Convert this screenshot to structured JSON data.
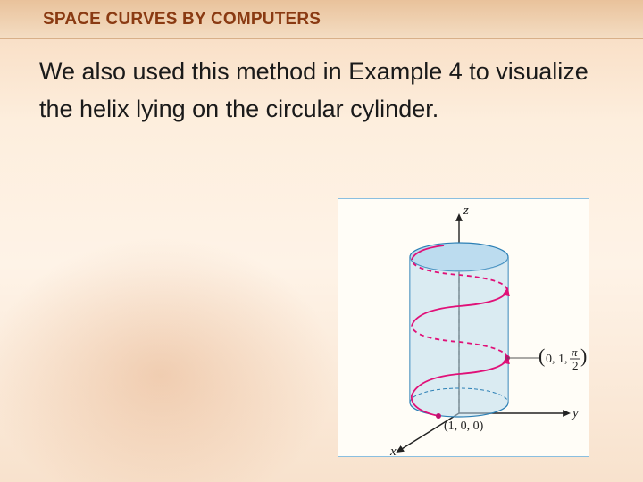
{
  "title": "SPACE CURVES BY COMPUTERS",
  "body_text": "We also used this method in Example 4 to visualize the helix lying on the circular cylinder.",
  "figure": {
    "axes": {
      "x": "x",
      "y": "y",
      "z": "z"
    },
    "point_x": "(1, 0, 0)",
    "point_y": "(0, 1, π⁄2)",
    "point_y_parts": {
      "lp": "(",
      "a": "0, 1, ",
      "num": "π",
      "den": "2",
      "rp": ")"
    }
  },
  "chart_data": {
    "type": "diagram",
    "description": "3D coordinate system with circular cylinder of radius 1 centered on the z-axis and a helix wrapping upward around it",
    "cylinder": {
      "axis": "z",
      "radius": 1
    },
    "helix_parametric": {
      "x": "cos t",
      "y": "sin t",
      "z": "t",
      "t_range": [
        0,
        12.56
      ]
    },
    "labeled_points": [
      {
        "coords": [
          1,
          0,
          0
        ],
        "label": "(1, 0, 0)"
      },
      {
        "coords": [
          0,
          1,
          1.5708
        ],
        "label": "(0, 1, π/2)"
      }
    ]
  }
}
